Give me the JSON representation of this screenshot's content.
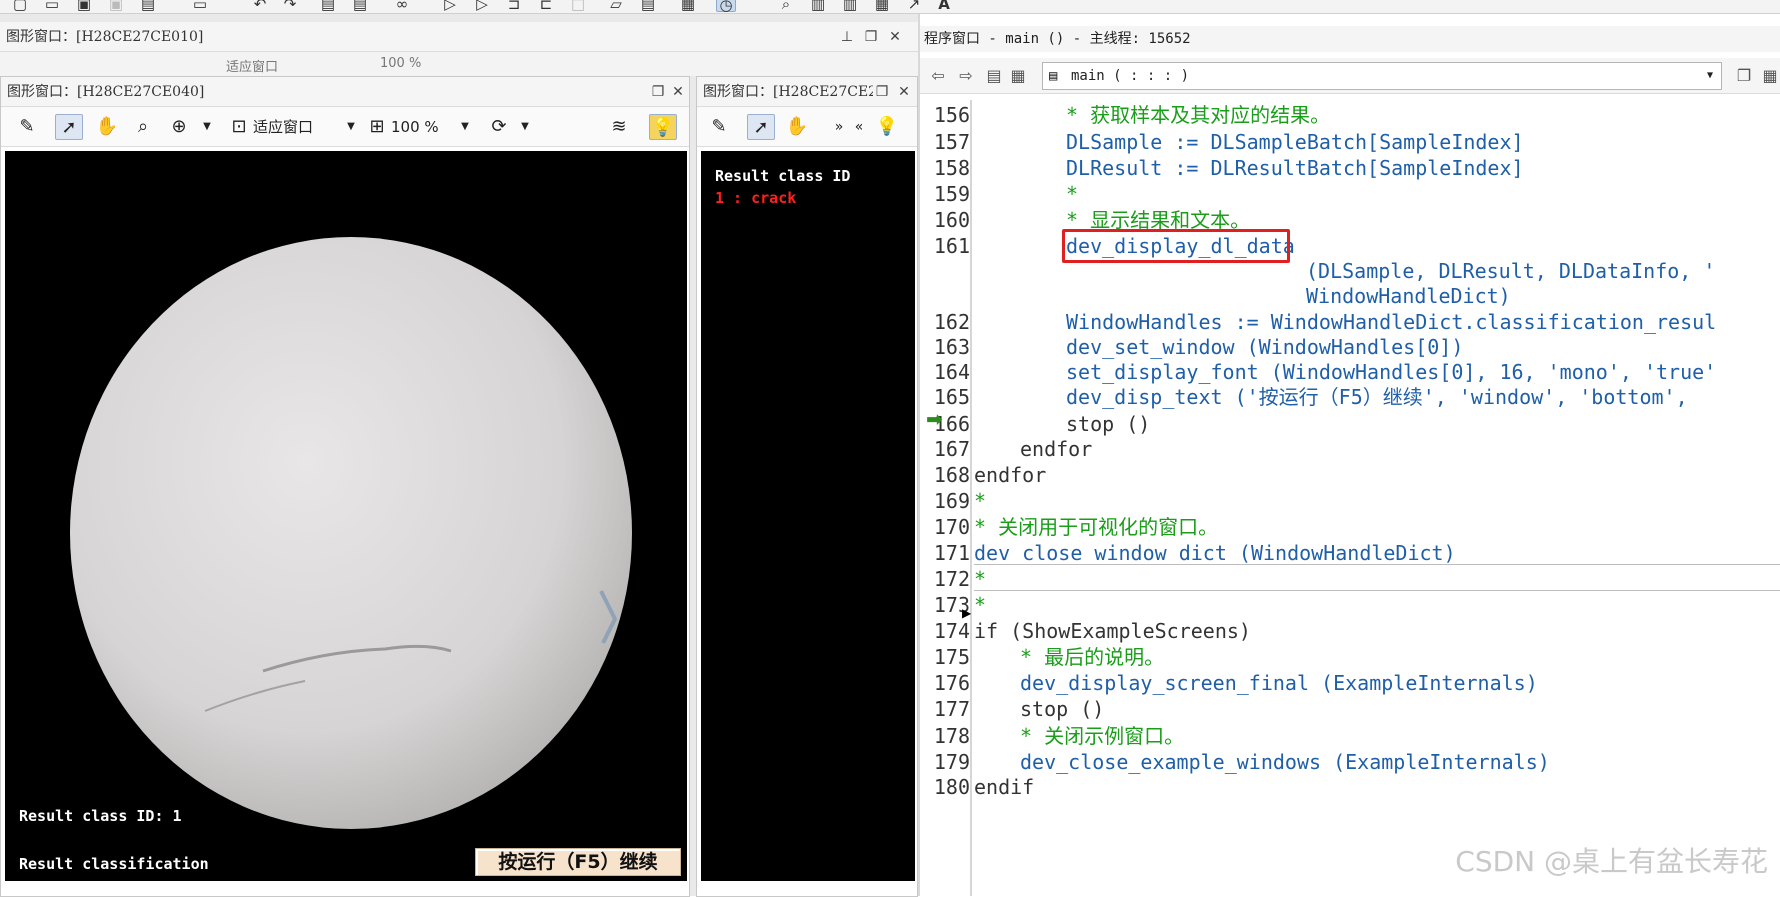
{
  "top_toolbar": {
    "icons": [
      "new-file-icon",
      "open-icon",
      "save-icon",
      "save-disabled-icon",
      "save-all-icon",
      "print-icon",
      "undo-icon",
      "redo-icon",
      "add-breakpoint-icon",
      "remove-breakpoint-icon",
      "binoculars-icon",
      "run-icon",
      "step-icon",
      "step-over-icon",
      "step-into-icon",
      "stop-icon",
      "insert-icon",
      "list-icon",
      "image-icon",
      "clock-icon",
      "search-icon",
      "chart-icon",
      "chart2-icon",
      "line-icon",
      "font-icon"
    ]
  },
  "graphics_window_back": {
    "title": "图形窗口：[H28CE27CE010]",
    "fit_label": "适应窗口",
    "zoom_label": "100 %"
  },
  "graphics_window_main": {
    "title": "图形窗口：[H28CE27CE040]",
    "fit_label": "适应窗口",
    "zoom_label": "100 %",
    "result_class_text": "Result class ID: 1",
    "result_caption": "Result classification",
    "continue_label": "按运行（F5）继续"
  },
  "graphics_window_side": {
    "title": "图形窗口：[H28CE27CE2",
    "heading": "Result class ID",
    "class_entry": "1 : crack"
  },
  "program_window": {
    "title": "程序窗口 - main () - 主线程: 15652",
    "procedure": "main ( : : : )",
    "watermark": "CSDN @桌上有盆长寿花",
    "lines": [
      {
        "n": "156",
        "text": "    * 获取样本及其对应的结果。"
      },
      {
        "n": "157",
        "text": "    DLSample := DLSampleBatch[SampleIndex]"
      },
      {
        "n": "158",
        "text": "    DLResult := DLResultBatch[SampleIndex]"
      },
      {
        "n": "159",
        "text": "    *"
      },
      {
        "n": "160",
        "text": "    * 显示结果和文本。"
      },
      {
        "n": "161",
        "text": "dev_display_dl_data"
      },
      {
        "n": "",
        "text": "(DLSample, DLResult, DLDataInfo, '"
      },
      {
        "n": "",
        "text": "WindowHandleDict)"
      },
      {
        "n": "162",
        "text": "    WindowHandles := WindowHandleDict.classification_resul"
      },
      {
        "n": "163",
        "text": "    dev_set_window (WindowHandles[0])"
      },
      {
        "n": "164",
        "text": "    set_display_font (WindowHandles[0], 16, 'mono', 'true'"
      },
      {
        "n": "165",
        "text": "    dev_disp_text ('按运行（F5）继续', 'window', 'bottom',"
      },
      {
        "n": "166",
        "text": "    stop ()"
      },
      {
        "n": "167",
        "text": "  endfor"
      },
      {
        "n": "168",
        "text": "endfor"
      },
      {
        "n": "169",
        "text": "*"
      },
      {
        "n": "170",
        "text": "* 关闭用于可视化的窗口。"
      },
      {
        "n": "171",
        "text": "dev_close_window_dict (WindowHandleDict)"
      },
      {
        "n": "172",
        "text": "*"
      },
      {
        "n": "173",
        "text": "*"
      },
      {
        "n": "174",
        "text": "if (ShowExampleScreens)"
      },
      {
        "n": "175",
        "text": "  * 最后的说明。"
      },
      {
        "n": "176",
        "text": "  dev_display_screen_final (ExampleInternals)"
      },
      {
        "n": "177",
        "text": "  stop ()"
      },
      {
        "n": "178",
        "text": "  * 关闭示例窗口。"
      },
      {
        "n": "179",
        "text": "  dev_close_example_windows (ExampleInternals)"
      },
      {
        "n": "180",
        "text": "endif"
      }
    ]
  }
}
